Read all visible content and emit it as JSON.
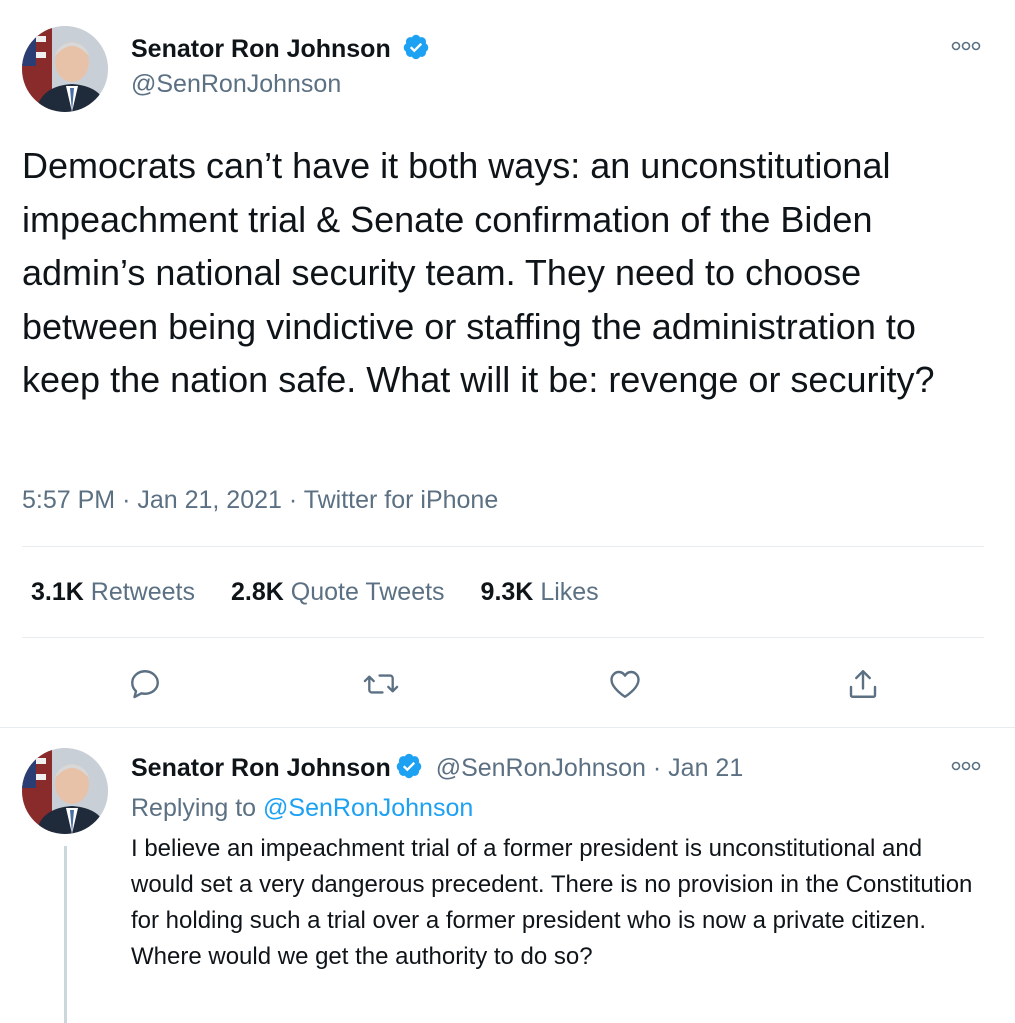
{
  "main_tweet": {
    "author_name": "Senator Ron Johnson",
    "author_handle": "@SenRonJohnson",
    "text": "Democrats can’t have it both ways: an unconstitutional impeachment trial & Senate confirmation of the Biden admin’s national security team. They need to choose between being vindictive or staffing the administration to keep the nation safe. What will it be: revenge or security?",
    "time": "5:57 PM",
    "date": "Jan 21, 2021",
    "source": "Twitter for iPhone",
    "stats": {
      "retweets_count": "3.1K",
      "retweets_label": "Retweets",
      "quotes_count": "2.8K",
      "quotes_label": "Quote Tweets",
      "likes_count": "9.3K",
      "likes_label": "Likes"
    },
    "actions": [
      "reply-icon",
      "retweet-icon",
      "like-icon",
      "share-icon"
    ]
  },
  "reply_tweet": {
    "author_name": "Senator Ron Johnson",
    "author_handle": "@SenRonJohnson",
    "date": "Jan 21",
    "replying_prefix": "Replying to",
    "replying_to": "@SenRonJohnson",
    "text": "I believe an impeachment trial of a former president is unconstitutional and would set a very dangerous precedent. There is no provision in the Constitution for holding such a trial over a former president who is now a private citizen. Where would we get the authority to do so?"
  },
  "colors": {
    "accent": "#1da1f2",
    "secondary_text": "#5b7083",
    "primary_text": "#0f1419",
    "divider": "#e6ecf0"
  }
}
